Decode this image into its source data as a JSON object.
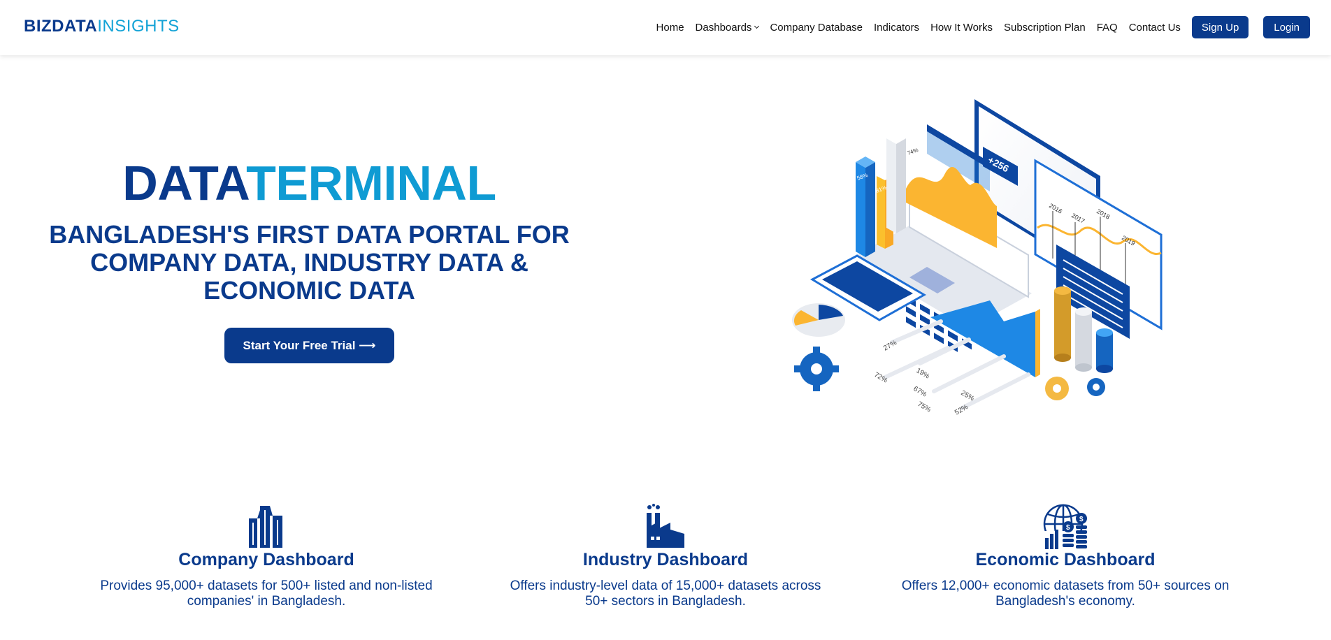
{
  "header": {
    "logo_part1": "BIZDATA",
    "logo_part2": "INSIGHTS",
    "nav": {
      "home": "Home",
      "dashboards": "Dashboards",
      "company_database": "Company Database",
      "indicators": "Indicators",
      "how_it_works": "How It Works",
      "subscription_plan": "Subscription Plan",
      "faq": "FAQ",
      "contact_us": "Contact Us"
    },
    "signup_label": "Sign Up",
    "login_label": "Login"
  },
  "hero": {
    "title_part1": "DATA",
    "title_part2": "TERMINAL",
    "subtitle": "BANGLADESH'S FIRST DATA PORTAL FOR COMPANY DATA, INDUSTRY DATA & ECONOMIC DATA",
    "cta_label": "Start Your Free Trial ⟶",
    "illustration": {
      "badge": "+256",
      "years": [
        "2016",
        "2017",
        "2018",
        "2019"
      ],
      "bar_labels": [
        "58%",
        "81%",
        "74%"
      ],
      "percent_labels": [
        "27%",
        "19%",
        "72%",
        "67%",
        "75%",
        "25%",
        "52%"
      ]
    }
  },
  "features": [
    {
      "icon": "building-icon",
      "title": "Company Dashboard",
      "text": "Provides 95,000+ datasets for 500+ listed and non-listed companies' in Bangladesh."
    },
    {
      "icon": "factory-icon",
      "title": "Industry Dashboard",
      "text": "Offers industry-level data of 15,000+ datasets across 50+ sectors in Bangladesh."
    },
    {
      "icon": "globe-coins-icon",
      "title": "Economic Dashboard",
      "text": "Offers 12,000+ economic datasets from 50+ sources on Bangladesh's economy."
    }
  ],
  "colors": {
    "brand_dark": "#0a3a8c",
    "brand_light": "#0f9bd3",
    "accent_yellow": "#fbb531"
  }
}
